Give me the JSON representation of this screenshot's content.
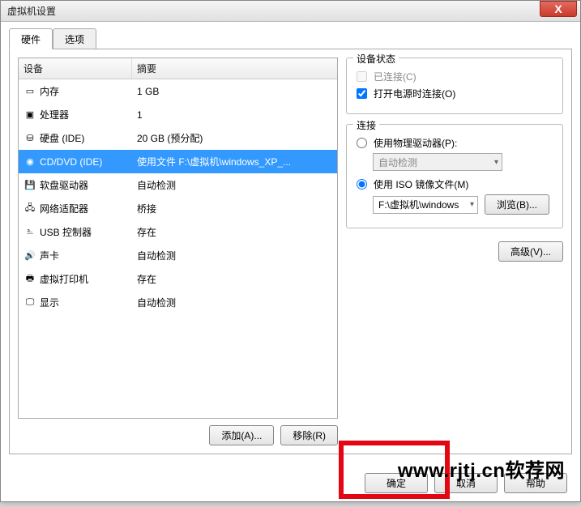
{
  "window": {
    "title": "虚拟机设置",
    "close_x": "X"
  },
  "tabs": {
    "hardware": "硬件",
    "options": "选项"
  },
  "table": {
    "col_device": "设备",
    "col_summary": "摘要",
    "rows": [
      {
        "icon": "memory-icon",
        "glyph": "▭",
        "name": "内存",
        "summary": "1 GB"
      },
      {
        "icon": "cpu-icon",
        "glyph": "▣",
        "name": "处理器",
        "summary": "1"
      },
      {
        "icon": "disk-icon",
        "glyph": "⛁",
        "name": "硬盘 (IDE)",
        "summary": "20 GB (预分配)"
      },
      {
        "icon": "cd-icon",
        "glyph": "◉",
        "name": "CD/DVD (IDE)",
        "summary": "使用文件 F:\\虚拟机\\windows_XP_...",
        "selected": true
      },
      {
        "icon": "floppy-icon",
        "glyph": "💾",
        "name": "软盘驱动器",
        "summary": "自动检测"
      },
      {
        "icon": "network-icon",
        "glyph": "🖧",
        "name": "网络适配器",
        "summary": "桥接"
      },
      {
        "icon": "usb-icon",
        "glyph": "⎁",
        "name": "USB 控制器",
        "summary": "存在"
      },
      {
        "icon": "sound-icon",
        "glyph": "🔊",
        "name": "声卡",
        "summary": "自动检测"
      },
      {
        "icon": "printer-icon",
        "glyph": "🖶",
        "name": "虚拟打印机",
        "summary": "存在"
      },
      {
        "icon": "display-icon",
        "glyph": "🖵",
        "name": "显示",
        "summary": "自动检测"
      }
    ]
  },
  "left_buttons": {
    "add": "添加(A)...",
    "remove": "移除(R)"
  },
  "group_status": {
    "title": "设备状态",
    "connected": "已连接(C)",
    "connect_on_power": "打开电源时连接(O)"
  },
  "group_connection": {
    "title": "连接",
    "use_physical": "使用物理驱动器(P):",
    "physical_value": "自动检测",
    "use_iso": "使用 ISO 镜像文件(M)",
    "iso_value": "F:\\虚拟机\\windows",
    "browse": "浏览(B)..."
  },
  "advanced": "高级(V)...",
  "bottom": {
    "ok": "确定",
    "cancel": "取消",
    "help": "帮助"
  },
  "watermark": "www.rjtj.cn软荐网"
}
